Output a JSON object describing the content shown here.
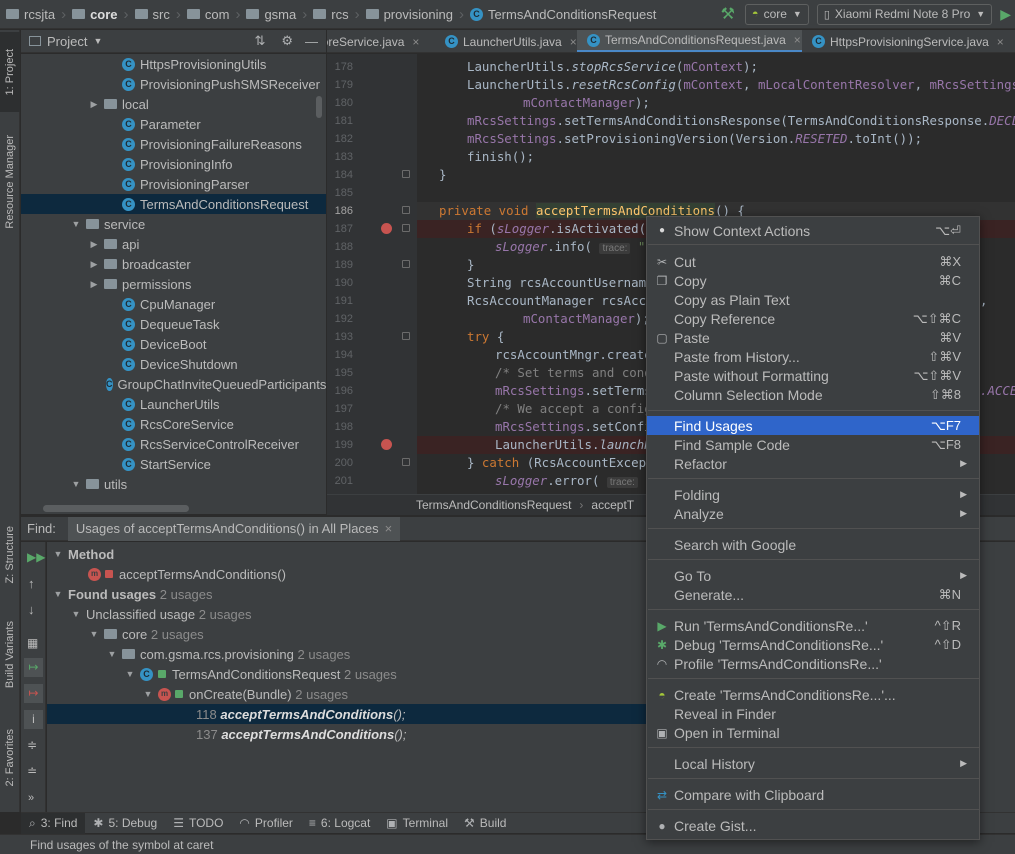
{
  "navbar": {
    "crumbs": [
      "rcsjta",
      "core",
      "src",
      "com",
      "gsma",
      "rcs",
      "provisioning",
      "TermsAndConditionsRequest"
    ],
    "module": "core",
    "device": "Xiaomi Redmi Note 8 Pro"
  },
  "left_strip": {
    "project": "1: Project",
    "resource_manager": "Resource Manager",
    "structure": "Z: Structure",
    "build_variants": "Build Variants",
    "favorites": "2: Favorites"
  },
  "project_panel": {
    "title": "Project",
    "items": [
      {
        "label": "HttpsProvisioningUtils",
        "type": "class"
      },
      {
        "label": "ProvisioningPushSMSReceiver",
        "type": "class"
      },
      {
        "label": "local",
        "type": "folder"
      },
      {
        "label": "Parameter",
        "type": "class"
      },
      {
        "label": "ProvisioningFailureReasons",
        "type": "class"
      },
      {
        "label": "ProvisioningInfo",
        "type": "class"
      },
      {
        "label": "ProvisioningParser",
        "type": "class"
      },
      {
        "label": "TermsAndConditionsRequest",
        "type": "class"
      },
      {
        "label": "service",
        "type": "folder"
      },
      {
        "label": "api",
        "type": "folder"
      },
      {
        "label": "broadcaster",
        "type": "folder"
      },
      {
        "label": "permissions",
        "type": "folder"
      },
      {
        "label": "CpuManager",
        "type": "class"
      },
      {
        "label": "DequeueTask",
        "type": "class"
      },
      {
        "label": "DeviceBoot",
        "type": "class"
      },
      {
        "label": "DeviceShutdown",
        "type": "class"
      },
      {
        "label": "GroupChatInviteQueuedParticipants",
        "type": "class"
      },
      {
        "label": "LauncherUtils",
        "type": "class"
      },
      {
        "label": "RcsCoreService",
        "type": "class"
      },
      {
        "label": "RcsServiceControlReceiver",
        "type": "class"
      },
      {
        "label": "StartService",
        "type": "class"
      },
      {
        "label": "utils",
        "type": "folder"
      }
    ]
  },
  "editor": {
    "tabs": [
      "CoreService.java",
      "LauncherUtils.java",
      "TermsAndConditionsRequest.java",
      "HttpsProvisioningService.java"
    ],
    "line_numbers": [
      "178",
      "179",
      "180",
      "181",
      "182",
      "183",
      "184",
      "185",
      "186",
      "187",
      "188",
      "189",
      "190",
      "191",
      "192",
      "193",
      "194",
      "195",
      "196",
      "197",
      "198",
      "199",
      "200",
      "201"
    ],
    "breadcrumb": [
      "TermsAndConditionsRequest",
      "acceptT"
    ],
    "hint_trace": "trace:",
    "code": {
      "l178a": "LauncherUtils.",
      "l178b": "stopRcsService",
      "l178c": "(",
      "l178d": "mContext",
      "l178e": ");",
      "l179a": "LauncherUtils.",
      "l179b": "resetRcsConfig",
      "l179c": "(",
      "l179d": "mContext",
      "l179e": ", ",
      "l179f": "mLocalContentResolver",
      "l179g": ", ",
      "l179h": "mRcsSettings",
      "l179i": ", ",
      "l179j": "mMe",
      "l180a": "mContactManager",
      "l180b": ");",
      "l181a": "mRcsSettings",
      "l181b": ".setTermsAndConditionsResponse(TermsAndConditionsResponse.",
      "l181c": "DECLINED",
      "l182a": "mRcsSettings",
      "l182b": ".setProvisioningVersion(Version.",
      "l182c": "RESETED",
      "l182d": ".toInt());",
      "l183": "finish();",
      "l184": "}",
      "l186a": "private void ",
      "l186b": "acceptTermsAndConditions",
      "l186c": "() {",
      "l187a": "if ",
      "l187b": "(",
      "l187c": "sLogger",
      "l187d": ".isActivated())",
      "l188a": "sLogger",
      "l188b": ".info( ",
      "l188c": "\"Us",
      "l189": "}",
      "l190": "String rcsAccountUsername",
      "l191a": "RcsAccountManager rcsAccou",
      "l191b": ",",
      "l192a": "mContactManager",
      "l192b": ");",
      "l193a": "try",
      "l193b": " {",
      "l194": "rcsAccountMngr.createR",
      "l195": "/* Set terms and condi",
      "l196a": "mRcsSettings",
      "l196b": ".setTermsA",
      "l196c": ".ACCE",
      "l197": "/* We accept a configu",
      "l198a": "mRcsSettings",
      "l198b": ".setConfig",
      "l199a": "LauncherUtils.",
      "l199b": "launchR",
      "l200a": "} ",
      "l200b": "catch",
      "l200c": " (RcsAccountExcepti",
      "l201a": "sLogger",
      "l201b": ".error( ",
      "l201c": "\"F"
    }
  },
  "find_panel": {
    "label": "Find:",
    "tab": "Usages of acceptTermsAndConditions() in All Places",
    "method_header": "Method",
    "method_name": "acceptTermsAndConditions()",
    "found_usages": "Found usages",
    "found_count": "2 usages",
    "unclassified": "Unclassified usage",
    "unclassified_count": "2 usages",
    "core": "core",
    "core_count": "2 usages",
    "package": "com.gsma.rcs.provisioning",
    "package_count": "2 usages",
    "class": "TermsAndConditionsRequest",
    "class_count": "2 usages",
    "method2": "onCreate(Bundle)",
    "method2_count": "2 usages",
    "usage1_line": "118",
    "usage1_text": "acceptTermsAndConditions",
    "usage2_line": "137",
    "usage2_text": "acceptTermsAndConditions",
    "call_suffix": "();"
  },
  "bottom_tabs": [
    "3: Find",
    "5: Debug",
    "TODO",
    "Profiler",
    "6: Logcat",
    "Terminal",
    "Build"
  ],
  "status": "Find usages of the symbol at caret",
  "context_menu": [
    {
      "label": "Show Context Actions",
      "shortcut": "⌥⏎",
      "icon": "bulb-icon"
    },
    {
      "label": "Cut",
      "shortcut": "⌘X",
      "icon": "scissors-icon"
    },
    {
      "label": "Copy",
      "shortcut": "⌘C",
      "icon": "copy-icon"
    },
    {
      "label": "Copy as Plain Text",
      "shortcut": ""
    },
    {
      "label": "Copy Reference",
      "shortcut": "⌥⇧⌘C"
    },
    {
      "label": "Paste",
      "shortcut": "⌘V",
      "icon": "paste-icon"
    },
    {
      "label": "Paste from History...",
      "shortcut": "⇧⌘V"
    },
    {
      "label": "Paste without Formatting",
      "shortcut": "⌥⇧⌘V"
    },
    {
      "label": "Column Selection Mode",
      "shortcut": "⇧⌘8"
    },
    {
      "label": "Find Usages",
      "shortcut": "⌥F7",
      "highlighted": true
    },
    {
      "label": "Find Sample Code",
      "shortcut": "⌥F8"
    },
    {
      "label": "Refactor",
      "submenu": true
    },
    {
      "label": "Folding",
      "submenu": true
    },
    {
      "label": "Analyze",
      "submenu": true
    },
    {
      "label": "Search with Google"
    },
    {
      "label": "Go To",
      "submenu": true
    },
    {
      "label": "Generate...",
      "shortcut": "⌘N"
    },
    {
      "label": "Run 'TermsAndConditionsRe...'",
      "shortcut": "^⇧R",
      "icon": "run-icon"
    },
    {
      "label": "Debug 'TermsAndConditionsRe...'",
      "shortcut": "^⇧D",
      "icon": "debug-icon"
    },
    {
      "label": "Profile 'TermsAndConditionsRe...'",
      "icon": "profile-icon"
    },
    {
      "label": "Create 'TermsAndConditionsRe...'...",
      "icon": "android-icon"
    },
    {
      "label": "Reveal in Finder"
    },
    {
      "label": "Open in Terminal",
      "icon": "terminal-icon"
    },
    {
      "label": "Local History",
      "submenu": true
    },
    {
      "label": "Compare with Clipboard",
      "icon": "compare-icon"
    },
    {
      "label": "Create Gist...",
      "icon": "github-icon"
    }
  ],
  "colors": {
    "menu_highlight": "#2f65ca",
    "selection": "#0d293e",
    "breakpoint": "#c75450",
    "class_icon": "#3592c4"
  }
}
